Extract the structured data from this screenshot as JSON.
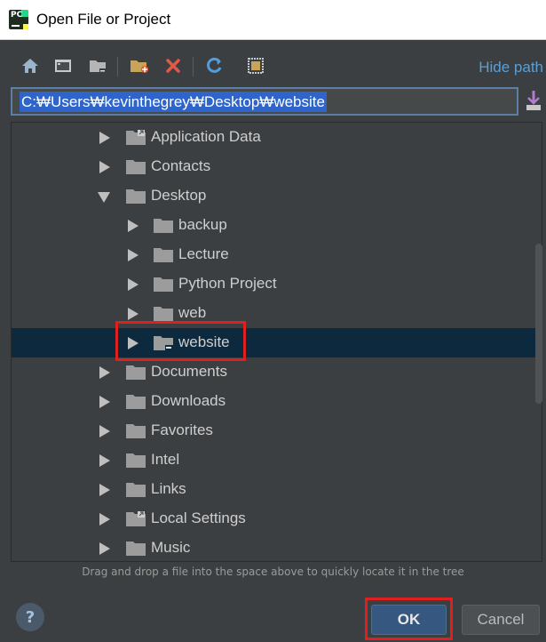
{
  "window": {
    "title": "Open File or Project",
    "logo_text": "PC"
  },
  "toolbar": {
    "buttons": [
      "home-icon",
      "desktop-icon",
      "project-folder-icon",
      "new-folder-icon",
      "delete-icon",
      "refresh-icon",
      "show-hidden-icon"
    ],
    "hide_path_label": "Hide path"
  },
  "path": {
    "value": "C:₩Users₩kevinthegrey₩Desktop₩website"
  },
  "tree": {
    "items": [
      {
        "label": "Application Data",
        "expanded": false,
        "shortcut": true
      },
      {
        "label": "Contacts",
        "expanded": false
      },
      {
        "label": "Desktop",
        "expanded": true
      },
      {
        "label": "backup",
        "expanded": false
      },
      {
        "label": "Lecture",
        "expanded": false
      },
      {
        "label": "Python Project",
        "expanded": false
      },
      {
        "label": "web",
        "expanded": false
      },
      {
        "label": "website",
        "expanded": false,
        "selected": true,
        "project": true
      },
      {
        "label": "Documents",
        "expanded": false
      },
      {
        "label": "Downloads",
        "expanded": false
      },
      {
        "label": "Favorites",
        "expanded": false
      },
      {
        "label": "Intel",
        "expanded": false
      },
      {
        "label": "Links",
        "expanded": false
      },
      {
        "label": "Local Settings",
        "expanded": false,
        "shortcut": true
      },
      {
        "label": "Music",
        "expanded": false
      }
    ]
  },
  "footer": {
    "hint": "Drag and drop a file into the space above to quickly locate it in the tree",
    "help_label": "?",
    "ok_label": "OK",
    "cancel_label": "Cancel"
  },
  "colors": {
    "accent": "#365880",
    "selection": "#0d293e",
    "highlight": "#e02020",
    "link": "#5a9fd6"
  }
}
